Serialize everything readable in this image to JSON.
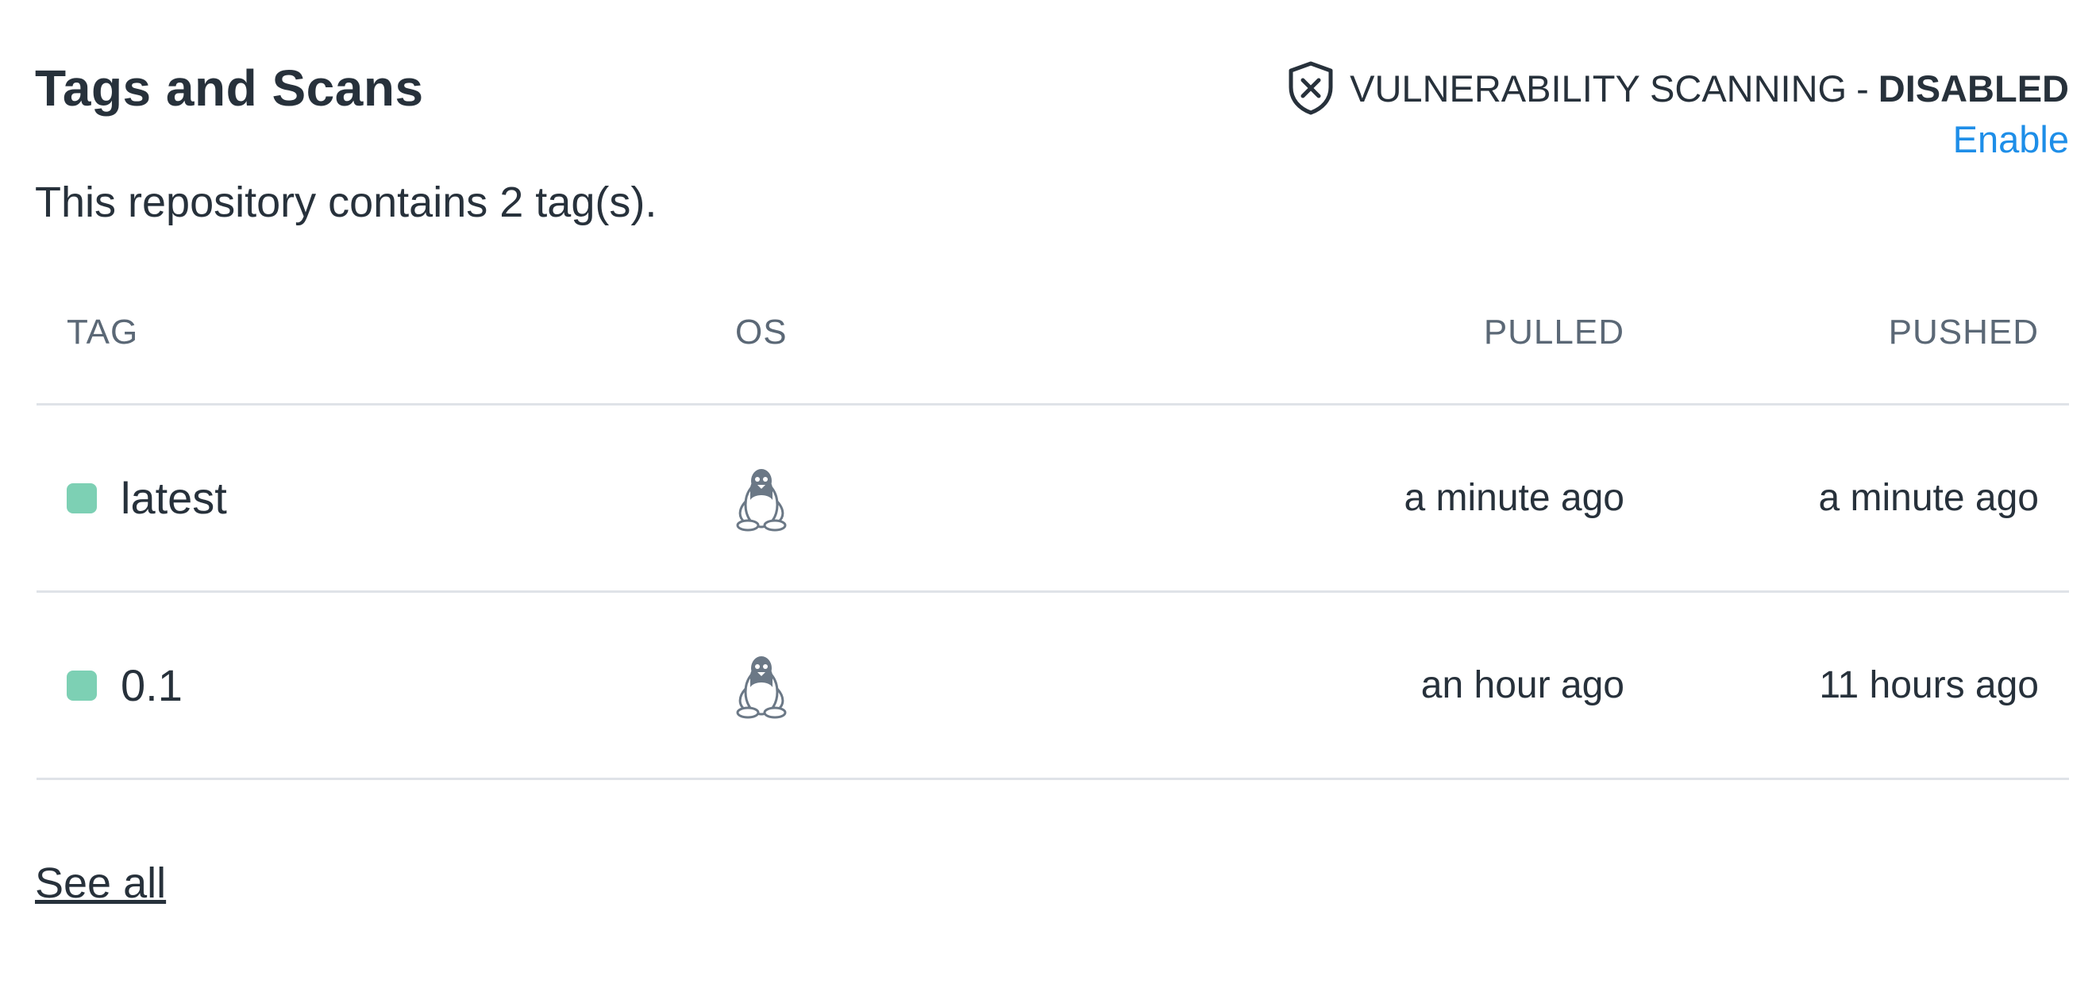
{
  "header": {
    "title": "Tags and Scans",
    "scanning_label": "VULNERABILITY SCANNING",
    "separator": "-",
    "scanning_state": "DISABLED",
    "enable_link": "Enable",
    "shield_icon": "shield-x-icon"
  },
  "summary": "This repository contains 2 tag(s).",
  "table": {
    "columns": [
      "TAG",
      "OS",
      "PULLED",
      "PUSHED"
    ],
    "rows": [
      {
        "tag": "latest",
        "os_icon": "linux-tux-icon",
        "pulled": "a minute ago",
        "pushed": "a minute ago",
        "status_color": "#7dd0b4"
      },
      {
        "tag": "0.1",
        "os_icon": "linux-tux-icon",
        "pulled": "an hour ago",
        "pushed": "11 hours ago",
        "status_color": "#7dd0b4"
      }
    ]
  },
  "footer": {
    "see_all": "See all"
  },
  "colors": {
    "text": "#27313b",
    "muted": "#5b6876",
    "link": "#1e8ee8",
    "status_ok": "#7dd0b4",
    "divider": "#dfe3e8"
  }
}
